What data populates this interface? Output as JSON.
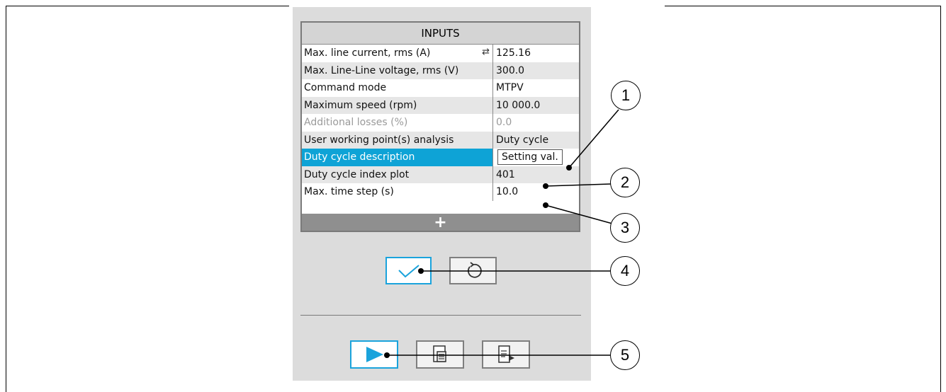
{
  "inputs": {
    "title": "INPUTS",
    "rows": [
      {
        "label": "Max. line current, rms (A)",
        "value": "125.16"
      },
      {
        "label": "Max. Line-Line voltage, rms (V)",
        "value": "300.0"
      },
      {
        "label": "Command mode",
        "value": "MTPV"
      },
      {
        "label": "Maximum speed (rpm)",
        "value": "10 000.0"
      },
      {
        "label": "Additional losses (%)",
        "value": "0.0"
      },
      {
        "label": "User working point(s) analysis",
        "value": "Duty cycle"
      },
      {
        "label": "Duty cycle description",
        "value": "Setting val."
      },
      {
        "label": "Duty cycle index plot",
        "value": "401"
      },
      {
        "label": "Max. time step (s)",
        "value": "10.0"
      }
    ],
    "add_label": "+"
  },
  "callouts": [
    "1",
    "2",
    "3",
    "4",
    "5"
  ],
  "colors": {
    "accent": "#0ea3d6",
    "panel": "#dcdcdc",
    "border": "#7a7a7a"
  },
  "icons": {
    "swap": "swap-arrows-icon",
    "validate": "checkmark-icon",
    "reset": "undo-circle-icon",
    "run": "play-icon",
    "report": "document-icon",
    "export": "export-document-icon"
  }
}
